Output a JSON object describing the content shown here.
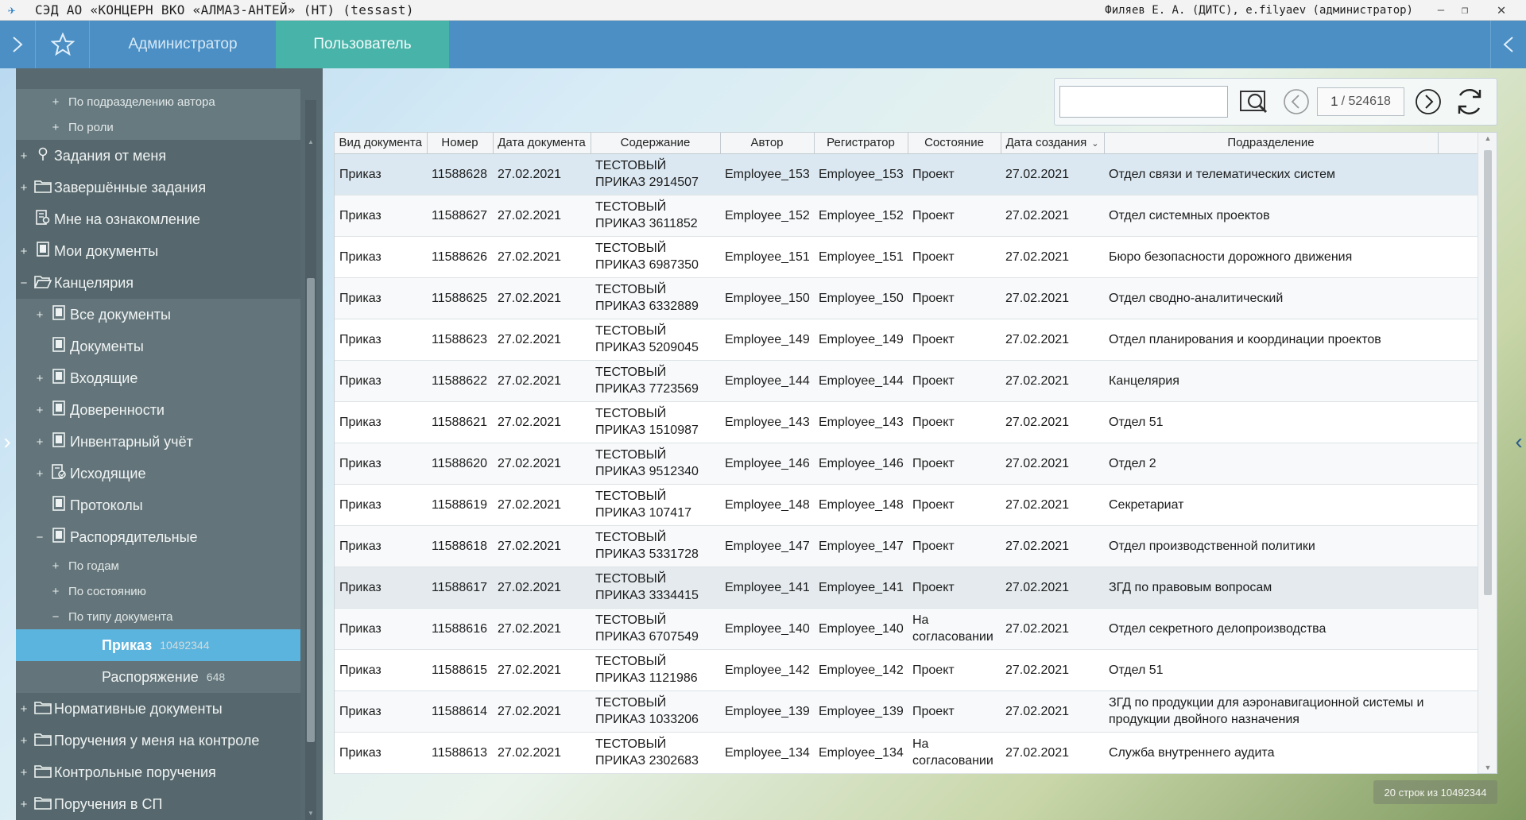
{
  "window": {
    "title": "СЭД АО «КОНЦЕРН ВКО «АЛМАЗ-АНТЕЙ» (НТ) (tessast)",
    "user": "Филяев Е. А. (ДИТС), e.filyaev (администратор)",
    "minimize": "–",
    "restore": "❐",
    "close": "✕"
  },
  "topnav": {
    "tabs": [
      {
        "label": "Администратор",
        "active": false
      },
      {
        "label": "Пользователь",
        "active": true
      }
    ]
  },
  "sidebar": {
    "items": [
      {
        "label": "По подразделению автора",
        "exp": "+",
        "level": 2
      },
      {
        "label": "По роли",
        "exp": "+",
        "level": 2
      },
      {
        "label": "Задания от меня",
        "exp": "+",
        "icon": "pin-icon",
        "level": 0
      },
      {
        "label": "Завершённые задания",
        "exp": "+",
        "icon": "folder-icon",
        "level": 0
      },
      {
        "label": "Мне на ознакомление",
        "exp": "",
        "icon": "document-review-icon",
        "level": 0
      },
      {
        "label": "Мои документы",
        "exp": "+",
        "icon": "document-icon",
        "level": 0
      },
      {
        "label": "Канцелярия",
        "exp": "−",
        "icon": "folder-open-icon",
        "level": 0
      },
      {
        "label": "Все документы",
        "exp": "+",
        "icon": "document-icon",
        "level": 1
      },
      {
        "label": "Документы",
        "exp": "",
        "icon": "document-icon",
        "level": 1
      },
      {
        "label": "Входящие",
        "exp": "+",
        "icon": "document-icon",
        "level": 1
      },
      {
        "label": "Доверенности",
        "exp": "+",
        "icon": "document-icon",
        "level": 1
      },
      {
        "label": "Инвентарный учёт",
        "exp": "+",
        "icon": "document-icon",
        "level": 1
      },
      {
        "label": "Исходящие",
        "exp": "+",
        "icon": "document-stamp-icon",
        "level": 1
      },
      {
        "label": "Протоколы",
        "exp": "",
        "icon": "document-icon",
        "level": 1
      },
      {
        "label": "Распорядительные",
        "exp": "−",
        "icon": "document-icon",
        "level": 1
      },
      {
        "label": "По годам",
        "exp": "+",
        "level": 3
      },
      {
        "label": "По состоянию",
        "exp": "+",
        "level": 3
      },
      {
        "label": "По типу документа",
        "exp": "−",
        "level": 3
      },
      {
        "label": "Приказ",
        "count": "10492344",
        "level": 4,
        "selected": true
      },
      {
        "label": "Распоряжение",
        "count": "648",
        "level": 4
      },
      {
        "label": "Нормативные документы",
        "exp": "+",
        "icon": "folder-icon",
        "level": 0
      },
      {
        "label": "Поручения у меня на контроле",
        "exp": "+",
        "icon": "folder-icon",
        "level": 0
      },
      {
        "label": "Контрольные поручения",
        "exp": "+",
        "icon": "folder-icon",
        "level": 0
      },
      {
        "label": "Поручения в СП",
        "exp": "+",
        "icon": "folder-icon",
        "level": 0
      }
    ]
  },
  "toolbar": {
    "search_value": "",
    "page_current": "1",
    "page_total": "/ 524618"
  },
  "grid": {
    "columns": [
      "Вид документа",
      "Номер",
      "Дата документа",
      "Содержание",
      "Автор",
      "Регистратор",
      "Состояние",
      "Дата создания",
      "Подразделение"
    ],
    "rows": [
      [
        "Приказ",
        "11588628",
        "27.02.2021",
        "ТЕСТОВЫЙ ПРИКАЗ 2914507",
        "Employee_153",
        "Employee_153",
        "Проект",
        "27.02.2021",
        "Отдел связи и телематических систем"
      ],
      [
        "Приказ",
        "11588627",
        "27.02.2021",
        "ТЕСТОВЫЙ ПРИКАЗ 3611852",
        "Employee_152",
        "Employee_152",
        "Проект",
        "27.02.2021",
        "Отдел системных проектов"
      ],
      [
        "Приказ",
        "11588626",
        "27.02.2021",
        "ТЕСТОВЫЙ ПРИКАЗ 6987350",
        "Employee_151",
        "Employee_151",
        "Проект",
        "27.02.2021",
        "Бюро безопасности дорожного движения"
      ],
      [
        "Приказ",
        "11588625",
        "27.02.2021",
        "ТЕСТОВЫЙ ПРИКАЗ 6332889",
        "Employee_150",
        "Employee_150",
        "Проект",
        "27.02.2021",
        "Отдел сводно-аналитический"
      ],
      [
        "Приказ",
        "11588623",
        "27.02.2021",
        "ТЕСТОВЫЙ ПРИКАЗ 5209045",
        "Employee_149",
        "Employee_149",
        "Проект",
        "27.02.2021",
        "Отдел планирования и координации проектов"
      ],
      [
        "Приказ",
        "11588622",
        "27.02.2021",
        "ТЕСТОВЫЙ ПРИКАЗ 7723569",
        "Employee_144",
        "Employee_144",
        "Проект",
        "27.02.2021",
        "Канцелярия"
      ],
      [
        "Приказ",
        "11588621",
        "27.02.2021",
        "ТЕСТОВЫЙ ПРИКАЗ 1510987",
        "Employee_143",
        "Employee_143",
        "Проект",
        "27.02.2021",
        "Отдел 51"
      ],
      [
        "Приказ",
        "11588620",
        "27.02.2021",
        "ТЕСТОВЫЙ ПРИКАЗ 9512340",
        "Employee_146",
        "Employee_146",
        "Проект",
        "27.02.2021",
        "Отдел 2"
      ],
      [
        "Приказ",
        "11588619",
        "27.02.2021",
        "ТЕСТОВЫЙ ПРИКАЗ 107417",
        "Employee_148",
        "Employee_148",
        "Проект",
        "27.02.2021",
        "Секретариат"
      ],
      [
        "Приказ",
        "11588618",
        "27.02.2021",
        "ТЕСТОВЫЙ ПРИКАЗ 5331728",
        "Employee_147",
        "Employee_147",
        "Проект",
        "27.02.2021",
        "Отдел производственной политики"
      ],
      [
        "Приказ",
        "11588617",
        "27.02.2021",
        "ТЕСТОВЫЙ ПРИКАЗ 3334415",
        "Employee_141",
        "Employee_141",
        "Проект",
        "27.02.2021",
        "ЗГД по правовым вопросам"
      ],
      [
        "Приказ",
        "11588616",
        "27.02.2021",
        "ТЕСТОВЫЙ ПРИКАЗ 6707549",
        "Employee_140",
        "Employee_140",
        "На согласовании",
        "27.02.2021",
        "Отдел секретного делопроизводства"
      ],
      [
        "Приказ",
        "11588615",
        "27.02.2021",
        "ТЕСТОВЫЙ ПРИКАЗ 1121986",
        "Employee_142",
        "Employee_142",
        "Проект",
        "27.02.2021",
        "Отдел 51"
      ],
      [
        "Приказ",
        "11588614",
        "27.02.2021",
        "ТЕСТОВЫЙ ПРИКАЗ 1033206",
        "Employee_139",
        "Employee_139",
        "Проект",
        "27.02.2021",
        "ЗГД по продукции для аэронавигационной системы и продукции двойного назначения"
      ],
      [
        "Приказ",
        "11588613",
        "27.02.2021",
        "ТЕСТОВЫЙ ПРИКАЗ 2302683",
        "Employee_134",
        "Employee_134",
        "На согласовании",
        "27.02.2021",
        "Служба внутреннего аудита"
      ]
    ]
  },
  "footer": {
    "count_text": "20 строк из 10492344"
  }
}
